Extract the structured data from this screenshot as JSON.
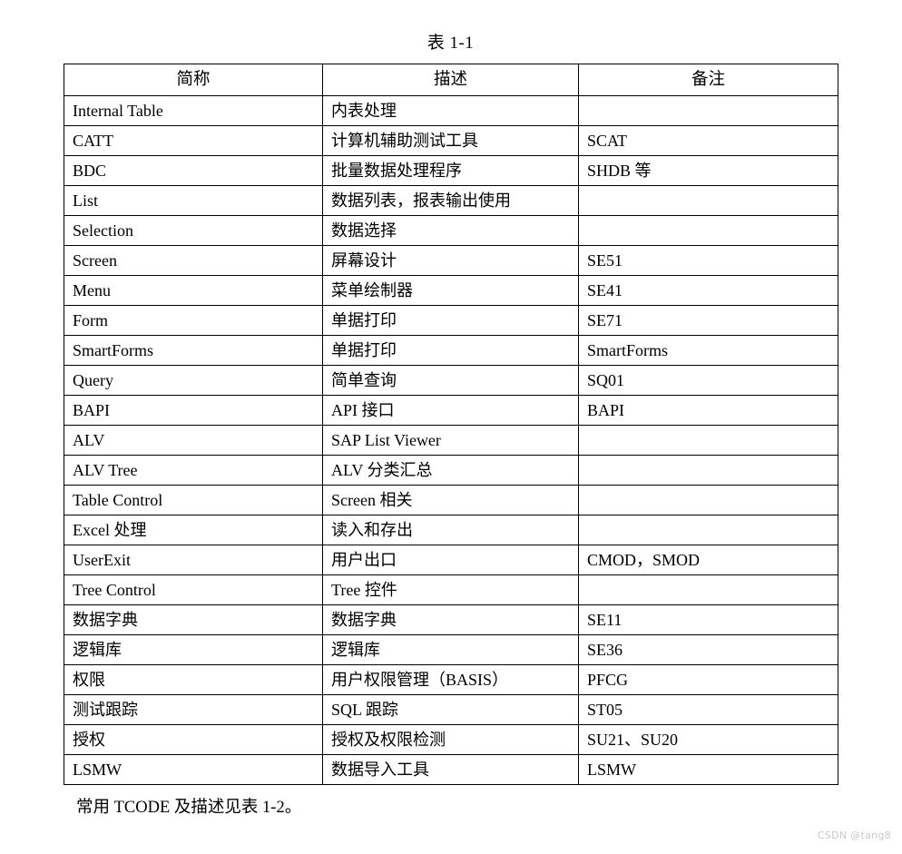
{
  "document": {
    "caption": "表 1-1",
    "footer_note": "常用 TCODE 及描述见表 1-2。",
    "watermark": "CSDN @tang8",
    "text_color": "#000000",
    "background_color": "#ffffff",
    "border_color": "#000000",
    "watermark_color": "#c8c8c8"
  },
  "table": {
    "columns": [
      {
        "header": "简称"
      },
      {
        "header": "描述"
      },
      {
        "header": "备注"
      }
    ],
    "rows": [
      {
        "abbr": "Internal Table",
        "desc": "内表处理",
        "remark": ""
      },
      {
        "abbr": "CATT",
        "desc": "计算机辅助测试工具",
        "remark": "SCAT"
      },
      {
        "abbr": "BDC",
        "desc": "批量数据处理程序",
        "remark": "SHDB 等"
      },
      {
        "abbr": "List",
        "desc": "数据列表，报表输出使用",
        "remark": ""
      },
      {
        "abbr": "Selection",
        "desc": "数据选择",
        "remark": ""
      },
      {
        "abbr": "Screen",
        "desc": "屏幕设计",
        "remark": "SE51"
      },
      {
        "abbr": "Menu",
        "desc": "菜单绘制器",
        "remark": "SE41"
      },
      {
        "abbr": "Form",
        "desc": "单据打印",
        "remark": "SE71"
      },
      {
        "abbr": "SmartForms",
        "desc": "单据打印",
        "remark": "SmartForms"
      },
      {
        "abbr": "Query",
        "desc": "简单查询",
        "remark": "SQ01"
      },
      {
        "abbr": "BAPI",
        "desc": "API 接口",
        "remark": "BAPI"
      },
      {
        "abbr": "ALV",
        "desc": "SAP List Viewer",
        "remark": ""
      },
      {
        "abbr": "ALV Tree",
        "desc": "ALV 分类汇总",
        "remark": ""
      },
      {
        "abbr": "Table Control",
        "desc": "Screen 相关",
        "remark": ""
      },
      {
        "abbr": "Excel 处理",
        "desc": "读入和存出",
        "remark": ""
      },
      {
        "abbr": "UserExit",
        "desc": "用户出口",
        "remark": "CMOD，SMOD"
      },
      {
        "abbr": "Tree Control",
        "desc": "Tree 控件",
        "remark": ""
      },
      {
        "abbr": "数据字典",
        "desc": "数据字典",
        "remark": "SE11"
      },
      {
        "abbr": "逻辑库",
        "desc": "逻辑库",
        "remark": "SE36"
      },
      {
        "abbr": "权限",
        "desc": "用户权限管理（BASIS）",
        "remark": "PFCG"
      },
      {
        "abbr": "测试跟踪",
        "desc": "SQL 跟踪",
        "remark": "ST05"
      },
      {
        "abbr": "授权",
        "desc": "授权及权限检测",
        "remark": "SU21、SU20"
      },
      {
        "abbr": "LSMW",
        "desc": "数据导入工具",
        "remark": "LSMW"
      }
    ]
  }
}
